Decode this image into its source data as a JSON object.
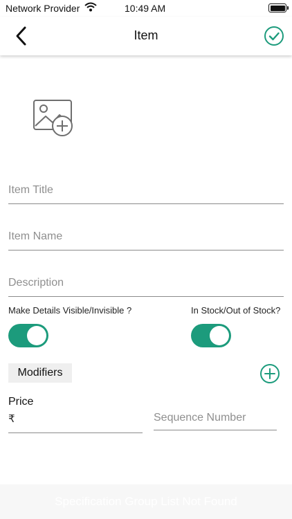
{
  "status_bar": {
    "carrier": "Network Provider",
    "time": "10:49 AM",
    "wifi_icon": "wifi-icon",
    "battery_icon": "battery-icon"
  },
  "nav": {
    "title": "Item",
    "back_icon": "chevron-left-icon",
    "save_icon": "check-circle-icon"
  },
  "colors": {
    "accent": "#1c9b7c",
    "text": "#222222",
    "placeholder": "#8f8f8f"
  },
  "image_picker": {
    "icon": "add-image-icon"
  },
  "fields": {
    "item_title": {
      "placeholder": "Item Title",
      "value": ""
    },
    "item_name": {
      "placeholder": "Item Name",
      "value": ""
    },
    "description": {
      "placeholder": "Description",
      "value": ""
    }
  },
  "toggles": {
    "details_visible": {
      "label": "Make Details Visible/Invisible ?",
      "on": true
    },
    "in_stock": {
      "label": "In Stock/Out of Stock?",
      "on": true
    }
  },
  "modifiers": {
    "label": "Modifiers",
    "add_icon": "plus-circle-icon"
  },
  "price": {
    "label": "Price",
    "currency": "₹",
    "value": ""
  },
  "sequence": {
    "placeholder": "Sequence Number",
    "value": ""
  },
  "footer": {
    "message": "Specification Group List Not Found"
  }
}
